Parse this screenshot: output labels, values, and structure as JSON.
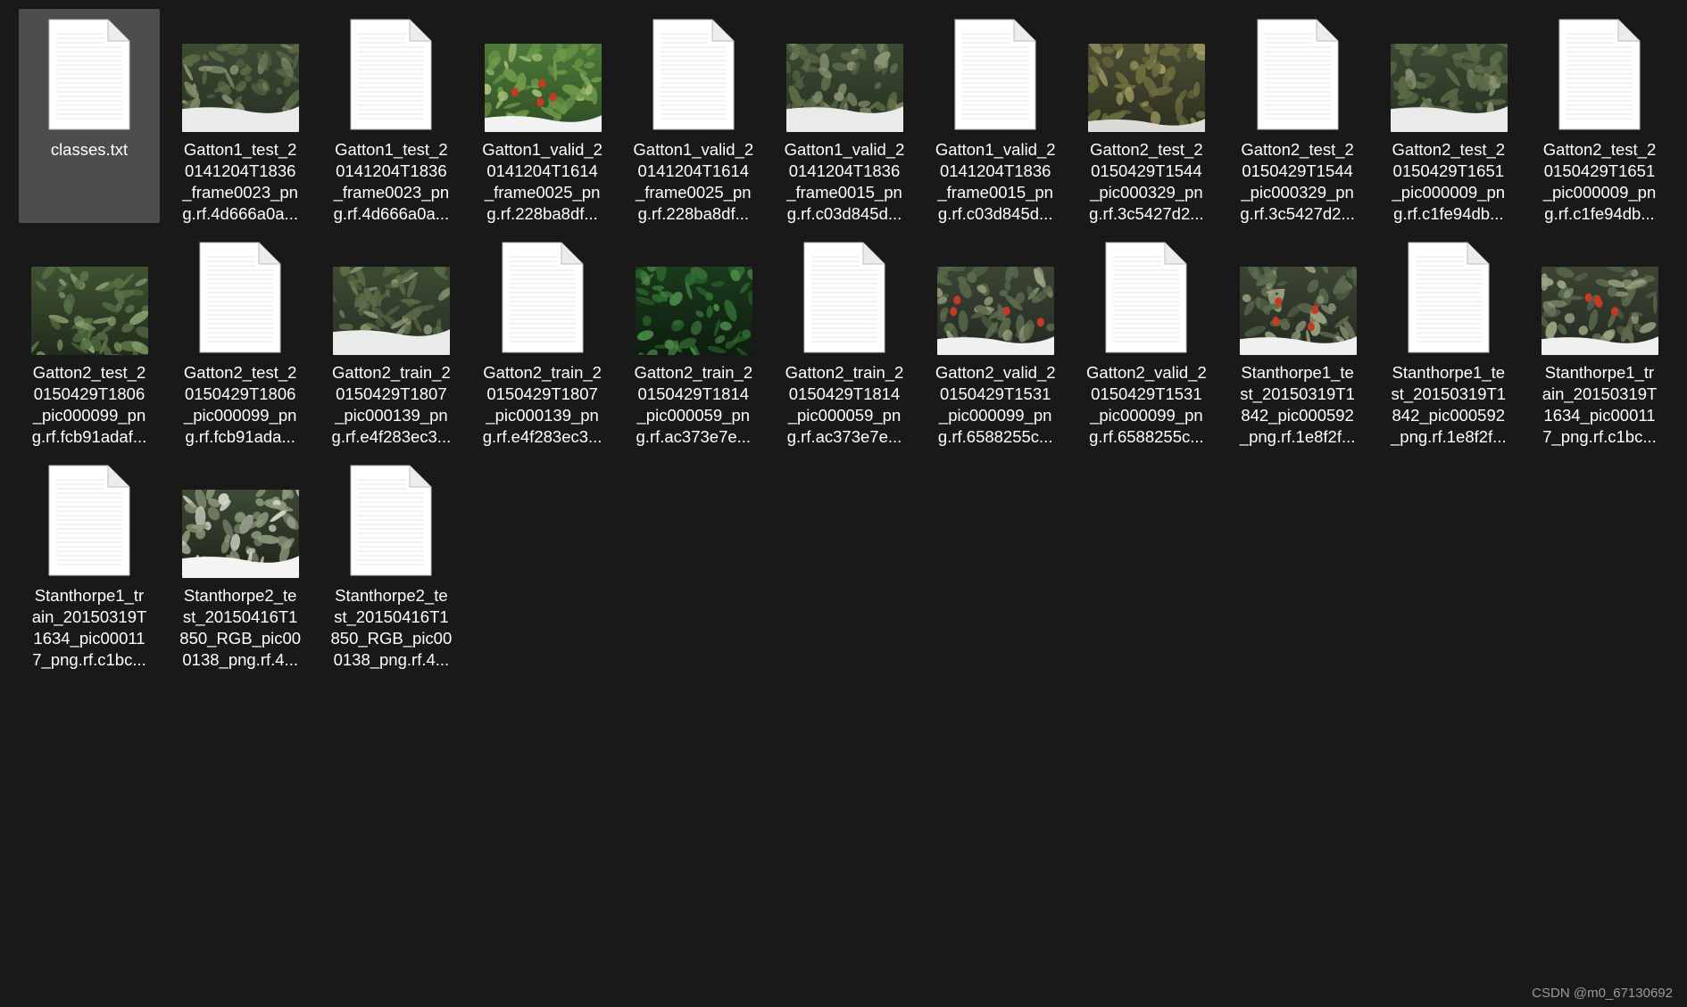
{
  "window": {
    "view": "Large icons",
    "background": "#191919"
  },
  "files": [
    {
      "icon": "text-file-icon",
      "selected": true,
      "label": "classes.txt"
    },
    {
      "icon": "image-thumbnail",
      "tone": "greenhouse-white-floor",
      "label": "Gatton1_test_2\n0141204T1836\n_frame0023_pn\ng.rf.4d666a0a..."
    },
    {
      "icon": "text-file-icon",
      "label": "Gatton1_test_2\n0141204T1836\n_frame0023_pn\ng.rf.4d666a0a..."
    },
    {
      "icon": "image-thumbnail",
      "tone": "greenhouse-bright-red",
      "label": "Gatton1_valid_2\n0141204T1614\n_frame0025_pn\ng.rf.228ba8df..."
    },
    {
      "icon": "text-file-icon",
      "label": "Gatton1_valid_2\n0141204T1614\n_frame0025_pn\ng.rf.228ba8df..."
    },
    {
      "icon": "image-thumbnail",
      "tone": "greenhouse-white-floor",
      "label": "Gatton1_valid_2\n0141204T1836\n_frame0015_pn\ng.rf.c03d845d..."
    },
    {
      "icon": "text-file-icon",
      "label": "Gatton1_valid_2\n0141204T1836\n_frame0015_pn\ng.rf.c03d845d..."
    },
    {
      "icon": "image-thumbnail",
      "tone": "greenhouse-yellow",
      "label": "Gatton2_test_2\n0150429T1544\n_pic000329_pn\ng.rf.3c5427d2..."
    },
    {
      "icon": "text-file-icon",
      "label": "Gatton2_test_2\n0150429T1544\n_pic000329_pn\ng.rf.3c5427d2..."
    },
    {
      "icon": "image-thumbnail",
      "tone": "greenhouse-white-floor",
      "label": "Gatton2_test_2\n0150429T1651\n_pic000009_pn\ng.rf.c1fe94db..."
    },
    {
      "icon": "text-file-icon",
      "label": "Gatton2_test_2\n0150429T1651\n_pic000009_pn\ng.rf.c1fe94db..."
    },
    {
      "icon": "image-thumbnail",
      "tone": "greenhouse-green",
      "label": "Gatton2_test_2\n0150429T1806\n_pic000099_pn\ng.rf.fcb91adaf..."
    },
    {
      "icon": "text-file-icon",
      "label": "Gatton2_test_2\n0150429T1806\n_pic000099_pn\ng.rf.fcb91ada..."
    },
    {
      "icon": "image-thumbnail",
      "tone": "greenhouse-white-floor",
      "label": "Gatton2_train_2\n0150429T1807\n_pic000139_pn\ng.rf.e4f283ec3..."
    },
    {
      "icon": "text-file-icon",
      "label": "Gatton2_train_2\n0150429T1807\n_pic000139_pn\ng.rf.e4f283ec3..."
    },
    {
      "icon": "image-thumbnail",
      "tone": "greenhouse-dark",
      "label": "Gatton2_train_2\n0150429T1814\n_pic000059_pn\ng.rf.ac373e7e..."
    },
    {
      "icon": "text-file-icon",
      "label": "Gatton2_train_2\n0150429T1814\n_pic000059_pn\ng.rf.ac373e7e..."
    },
    {
      "icon": "image-thumbnail",
      "tone": "greenhouse-red-floor",
      "label": "Gatton2_valid_2\n0150429T1531\n_pic000099_pn\ng.rf.6588255c..."
    },
    {
      "icon": "text-file-icon",
      "label": "Gatton2_valid_2\n0150429T1531\n_pic000099_pn\ng.rf.6588255c..."
    },
    {
      "icon": "image-thumbnail",
      "tone": "greenhouse-red-floor",
      "label": "Stanthorpe1_te\nst_20150319T1\n842_pic000592\n_png.rf.1e8f2f..."
    },
    {
      "icon": "text-file-icon",
      "label": "Stanthorpe1_te\nst_20150319T1\n842_pic000592\n_png.rf.1e8f2f..."
    },
    {
      "icon": "image-thumbnail",
      "tone": "greenhouse-red-floor",
      "label": "Stanthorpe1_tr\nain_20150319T\n1634_pic00011\n7_png.rf.c1bc..."
    },
    {
      "icon": "text-file-icon",
      "label": "Stanthorpe1_tr\nain_20150319T\n1634_pic00011\n7_png.rf.c1bc..."
    },
    {
      "icon": "image-thumbnail",
      "tone": "greenhouse-lit",
      "label": "Stanthorpe2_te\nst_20150416T1\n850_RGB_pic00\n0138_png.rf.4..."
    },
    {
      "icon": "text-file-icon",
      "label": "Stanthorpe2_te\nst_20150416T1\n850_RGB_pic00\n0138_png.rf.4..."
    }
  ],
  "watermark": "CSDN @m0_67130692"
}
